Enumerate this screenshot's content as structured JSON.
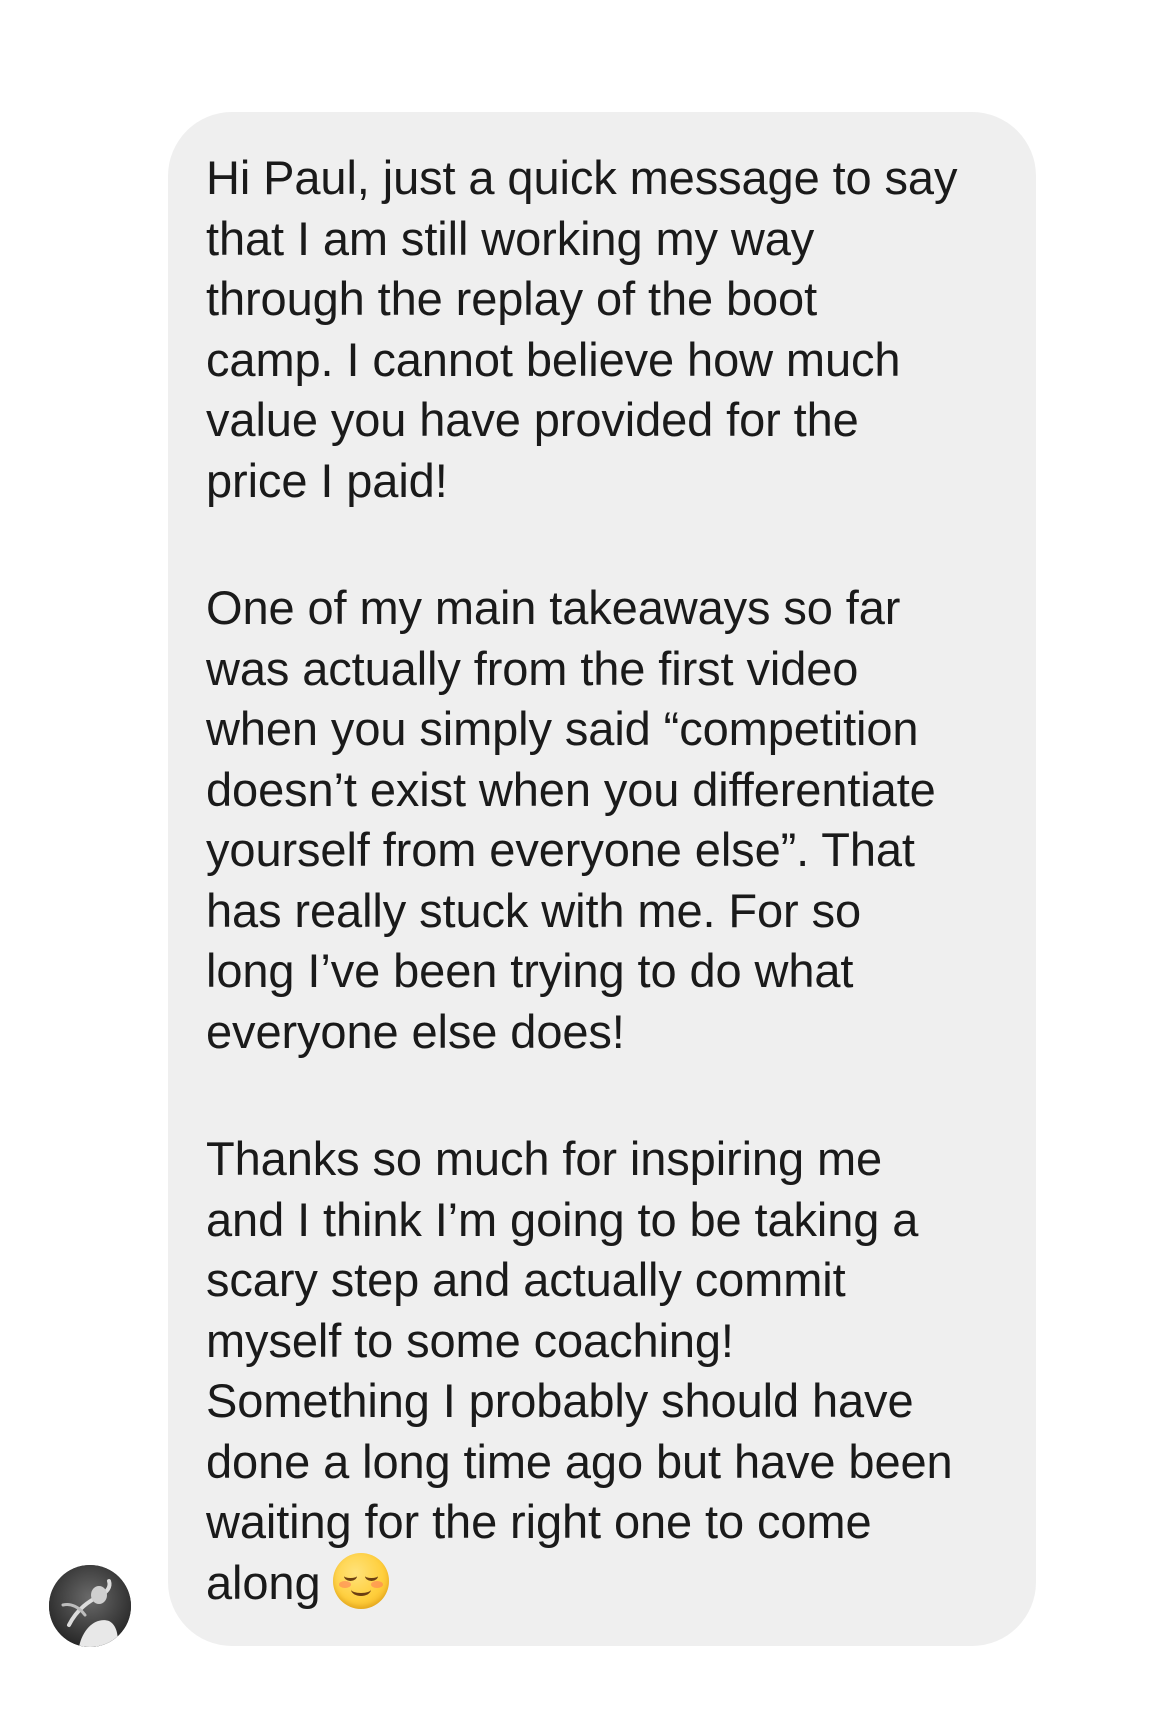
{
  "message": {
    "paragraphs": [
      [
        "Hi Paul, just a quick message to say",
        "that I am still working my way",
        "through the replay of the boot",
        "camp. I cannot believe how much",
        "value you have provided for the",
        "price I paid!"
      ],
      [
        "One of my main takeaways so far",
        "was actually from the first video",
        "when you simply said “competition",
        "doesn’t exist when you differentiate",
        "yourself from everyone else”. That",
        "has really stuck with me. For so",
        "long I’ve been trying to do what",
        "everyone else does!"
      ],
      [
        "Thanks so much for inspiring me",
        "and I think I’m going to be taking a",
        "scary step and actually commit",
        "myself to some coaching!",
        "Something I probably should have",
        "done a long time ago but have been",
        "waiting for the right one to come",
        "along"
      ]
    ],
    "emoji": "smiling-face-emoji",
    "bubble_color": "#efefef",
    "text_color": "#1a1a1a"
  },
  "sender": {
    "avatar_icon": "profile-photo"
  }
}
